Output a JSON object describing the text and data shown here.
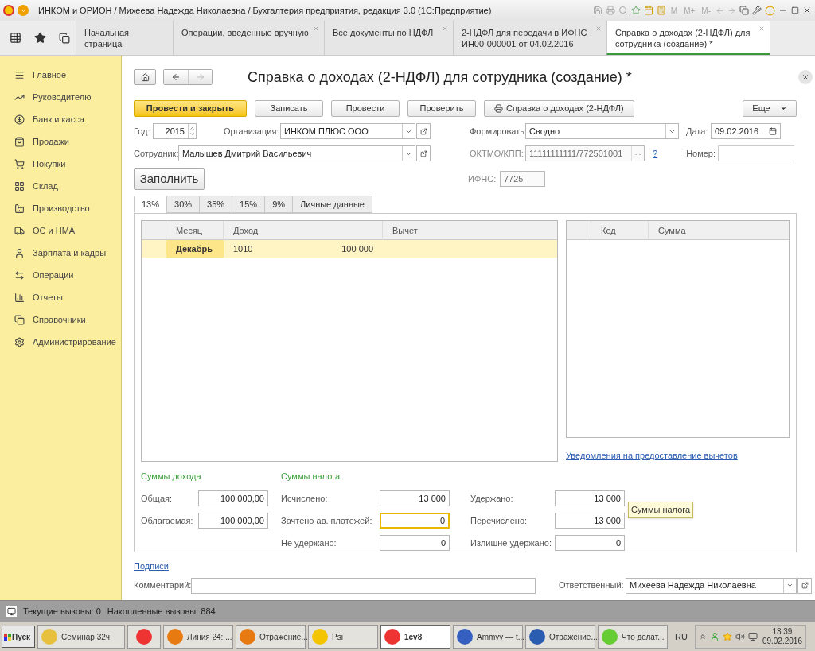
{
  "window": {
    "title": "ИНКОМ и ОРИОН / Михеева Надежда Николаевна / Бухгалтерия предприятия, редакция 3.0  (1С:Предприятие)",
    "memory_keys": [
      "M",
      "M+",
      "M-"
    ]
  },
  "open_tabs": [
    {
      "label": "Начальная страница",
      "closable": false,
      "selected": false
    },
    {
      "label": "Операции, введенные вручную",
      "closable": true,
      "selected": false
    },
    {
      "label": "Все документы по НДФЛ",
      "closable": true,
      "selected": false
    },
    {
      "label": "2-НДФЛ для передачи в ИФНС ИН00-000001 от 04.02.2016",
      "closable": true,
      "selected": false
    },
    {
      "label": "Справка о доходах (2-НДФЛ) для сотрудника (создание) *",
      "closable": true,
      "selected": true
    }
  ],
  "sidebar": {
    "items": [
      {
        "label": "Главное"
      },
      {
        "label": "Руководителю"
      },
      {
        "label": "Банк и касса"
      },
      {
        "label": "Продажи"
      },
      {
        "label": "Покупки"
      },
      {
        "label": "Склад"
      },
      {
        "label": "Производство"
      },
      {
        "label": "ОС и НМА"
      },
      {
        "label": "Зарплата и кадры"
      },
      {
        "label": "Операции"
      },
      {
        "label": "Отчеты"
      },
      {
        "label": "Справочники"
      },
      {
        "label": "Администрирование"
      }
    ]
  },
  "form": {
    "title": "Справка о доходах (2-НДФЛ) для сотрудника (создание) *",
    "toolbar": [
      {
        "label": "Провести и закрыть",
        "kind": "primary"
      },
      {
        "label": "Записать",
        "kind": "default"
      },
      {
        "label": "Провести",
        "kind": "default"
      },
      {
        "label": "Проверить",
        "kind": "default"
      },
      {
        "label": "Справка о доходах (2-НДФЛ)",
        "kind": "print"
      }
    ],
    "more": "Еще",
    "year": {
      "label": "Год:",
      "value": "2015"
    },
    "organization": {
      "label": "Организация:",
      "value": "ИНКОМ ПЛЮС ООО"
    },
    "mode": {
      "label": "Формировать:",
      "value": "Сводно"
    },
    "date": {
      "label": "Дата:",
      "value": "09.02.2016"
    },
    "employee": {
      "label": "Сотрудник:",
      "value": "Малышев Дмитрий Васильевич"
    },
    "oktmo": {
      "label": "ОКТМО/КПП:",
      "value": "11111111111/772501001",
      "disabled": true,
      "select_label": "...",
      "help": "?"
    },
    "number": {
      "label": "Номер:"
    },
    "fill_button": "Заполнить",
    "ifns": {
      "label": "ИФНС:",
      "value": "7725",
      "disabled": true
    },
    "rate_tabs": [
      {
        "label": "13%",
        "selected": true
      },
      {
        "label": "30%",
        "selected": false
      },
      {
        "label": "35%",
        "selected": false
      },
      {
        "label": "15%",
        "selected": false
      },
      {
        "label": "9%",
        "selected": false
      },
      {
        "label": "Личные данные",
        "selected": false
      }
    ],
    "income_table": {
      "columns": [
        "Месяц",
        "Доход",
        "Вычет"
      ],
      "rows": [
        {
          "month": "Декабрь",
          "code": "1010",
          "amount": "100 000",
          "selected": true
        }
      ]
    },
    "deduction_table": {
      "columns": [
        "Код",
        "Сумма"
      ]
    },
    "notifications_link": "Уведомления на предоставление вычетов",
    "income_sums": {
      "title": "Суммы дохода",
      "fields": [
        {
          "label": "Общая:",
          "value": "100 000,00"
        },
        {
          "label": "Облагаемая:",
          "value": "100 000,00"
        }
      ]
    },
    "tax_sums": {
      "title": "Суммы налога",
      "columns": [
        [
          {
            "label": "Исчислено:",
            "value": "13 000",
            "focused": false
          },
          {
            "label": "Зачтено ав. платежей:",
            "value": "0",
            "focused": true
          },
          {
            "label": "Не удержано:",
            "value": "0",
            "focused": false
          }
        ],
        [
          {
            "label": "Удержано:",
            "value": "13 000",
            "focused": false
          },
          {
            "label": "Перечислено:",
            "value": "13 000",
            "focused": false
          },
          {
            "label": "Излишне удержано:",
            "value": "0",
            "focused": false
          }
        ]
      ]
    },
    "tooltip": "Суммы налога",
    "signatures_link": "Подписи",
    "comment": {
      "label": "Комментарий:"
    },
    "responsible": {
      "label": "Ответственный:",
      "value": "Михеева Надежда Николаевна"
    }
  },
  "status_bar": {
    "current_calls": "Текущие вызовы: 0",
    "accumulated_calls": "Накопленные вызовы: 884"
  },
  "taskbar": {
    "start": "Пуск",
    "items": [
      {
        "label": "Семинар 32ч",
        "selected": false
      },
      {
        "selected": false
      },
      {
        "label": "Линия 24: ...",
        "selected": false
      },
      {
        "label": "Отражение...",
        "selected": false
      },
      {
        "label": "Psi",
        "selected": false
      },
      {
        "label": "1cv8",
        "selected": true
      },
      {
        "label": "Ammyy — t...",
        "selected": false
      },
      {
        "label": "Отражение...",
        "selected": false
      },
      {
        "label": "Что делат...",
        "selected": false
      }
    ],
    "language": "RU",
    "time": "13:39",
    "date": "09.02.2016"
  }
}
